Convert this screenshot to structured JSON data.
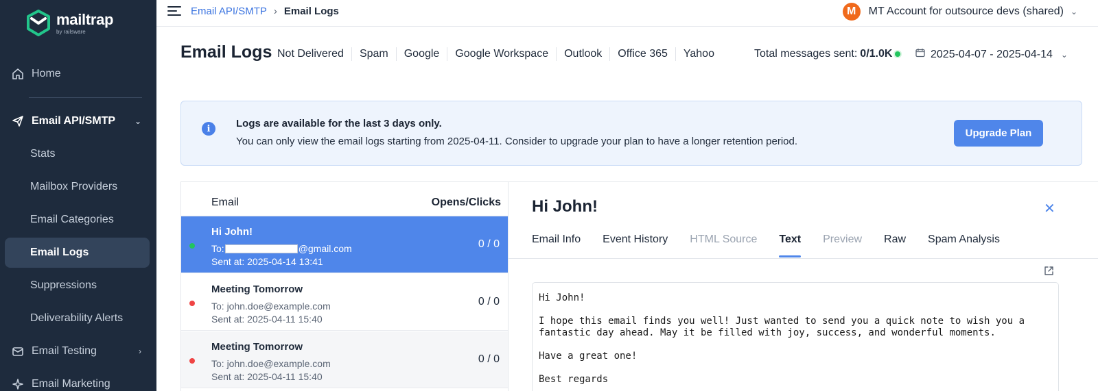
{
  "sidebar": {
    "logo": {
      "name": "mailtrap",
      "sub": "by railsware"
    },
    "items": [
      {
        "label": "Home",
        "icon": "home-icon"
      },
      {
        "label": "Email API/SMTP",
        "icon": "send-icon"
      },
      {
        "label": "Stats"
      },
      {
        "label": "Mailbox Providers"
      },
      {
        "label": "Email Categories"
      },
      {
        "label": "Email Logs"
      },
      {
        "label": "Suppressions"
      },
      {
        "label": "Deliverability Alerts"
      },
      {
        "label": "Email Testing",
        "icon": "inbox-icon"
      },
      {
        "label": "Email Marketing",
        "icon": "sparkle-icon"
      }
    ]
  },
  "topbar": {
    "breadcrumb_link": "Email API/SMTP",
    "breadcrumb_sep": "›",
    "breadcrumb_current": "Email Logs",
    "account_initial": "M",
    "account_name": "MT Account for outsource devs (shared)"
  },
  "header": {
    "title": "Email Logs",
    "filters": [
      "Not Delivered",
      "Spam",
      "Google",
      "Google Workspace",
      "Outlook",
      "Office 365",
      "Yahoo"
    ],
    "total_label": "Total messages sent:",
    "total_value": "0/1.0K",
    "date_range": "2025-04-07 - 2025-04-14"
  },
  "banner": {
    "title": "Logs are available for the last 3 days only.",
    "text": "You can only view the email logs starting from 2025-04-11. Consider to upgrade your plan to have a longer retention period.",
    "button": "Upgrade Plan"
  },
  "list": {
    "col_email": "Email",
    "col_opens": "Opens/Clicks",
    "rows": [
      {
        "subject": "Hi John!",
        "to_prefix": "To:",
        "to_suffix": "@gmail.com",
        "sent": "Sent at: 2025-04-14 13:41",
        "oc": "0 / 0",
        "status": "delivered"
      },
      {
        "subject": "Meeting Tomorrow",
        "to": "To: john.doe@example.com",
        "sent": "Sent at: 2025-04-11 15:40",
        "oc": "0 / 0",
        "status": "failed"
      },
      {
        "subject": "Meeting Tomorrow",
        "to": "To: john.doe@example.com",
        "sent": "Sent at: 2025-04-11 15:40",
        "oc": "0 / 0",
        "status": "failed"
      }
    ]
  },
  "detail": {
    "title": "Hi John!",
    "tabs": [
      "Email Info",
      "Event History",
      "HTML Source",
      "Text",
      "Preview",
      "Raw",
      "Spam Analysis"
    ],
    "active_tab": "Text",
    "disabled_tabs": [
      "HTML Source",
      "Preview"
    ],
    "body": "Hi John!\n\nI hope this email finds you well! Just wanted to send you a quick note to wish you a\nfantastic day ahead. May it be filled with joy, success, and wonderful moments.\n\nHave a great one!\n\nBest regards"
  },
  "colors": {
    "sidebar_bg": "#1e2b3d",
    "accent": "#4f86ea",
    "delivered": "#22c55e",
    "failed": "#ef4444",
    "avatar": "#f06a1c"
  }
}
